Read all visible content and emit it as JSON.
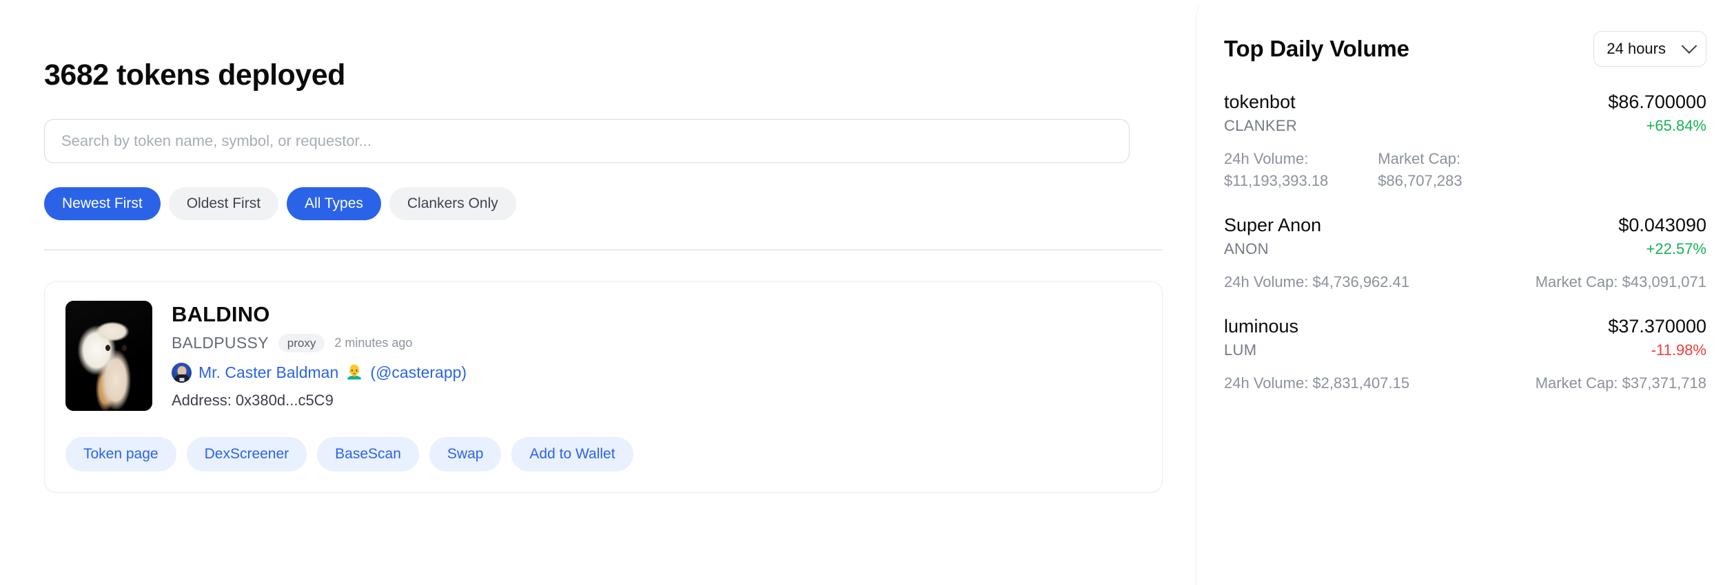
{
  "main": {
    "title": "3682 tokens deployed",
    "search": {
      "placeholder": "Search by token name, symbol, or requestor...",
      "value": ""
    },
    "filters": [
      {
        "label": "Newest First",
        "active": true
      },
      {
        "label": "Oldest First",
        "active": false
      },
      {
        "label": "All Types",
        "active": true
      },
      {
        "label": "Clankers Only",
        "active": false
      }
    ],
    "token_card": {
      "name": "BALDINO",
      "symbol": "BALDPUSSY",
      "badge": "proxy",
      "time": "2 minutes ago",
      "creator_name": "Mr. Caster Baldman",
      "creator_emoji": "👨‍🦲",
      "creator_handle": "(@casterapp)",
      "address_label": "Address: 0x380d...c5C9",
      "actions": [
        "Token page",
        "DexScreener",
        "BaseScan",
        "Swap",
        "Add to Wallet"
      ],
      "thumb_alt": "white fluffy cat photo"
    }
  },
  "sidebar": {
    "title": "Top Daily Volume",
    "range_selected": "24 hours",
    "labels": {
      "volume": "24h Volume:",
      "market_cap": "Market Cap:",
      "volume_inline": "24h Volume: ",
      "market_cap_inline": "Market Cap: "
    },
    "items": [
      {
        "name": "tokenbot",
        "symbol": "CLANKER",
        "price": "$86.700000",
        "change": "+65.84%",
        "change_dir": "up",
        "volume": "$11,193,393.18",
        "market_cap": "$86,707,283",
        "layout": "stacked"
      },
      {
        "name": "Super Anon",
        "symbol": "ANON",
        "price": "$0.043090",
        "change": "+22.57%",
        "change_dir": "up",
        "volume": "$4,736,962.41",
        "market_cap": "$43,091,071",
        "volume_inline": "24h Volume: $4,736,962.41",
        "market_cap_inline": "Market Cap: $43,091,071",
        "layout": "inline"
      },
      {
        "name": "luminous",
        "symbol": "LUM",
        "price": "$37.370000",
        "change": "-11.98%",
        "change_dir": "down",
        "volume": "$2,831,407.15",
        "market_cap": "$37,371,718",
        "volume_inline": "24h Volume: $2,831,407.15",
        "market_cap_inline": "Market Cap: $37,371,718",
        "layout": "inline"
      }
    ]
  },
  "colors": {
    "accent_blue": "#2b63e8",
    "action_bg": "#e9f0fe",
    "up_green": "#16b354",
    "down_red": "#ef3b3b",
    "pill_inactive": "#f1f2f4"
  }
}
